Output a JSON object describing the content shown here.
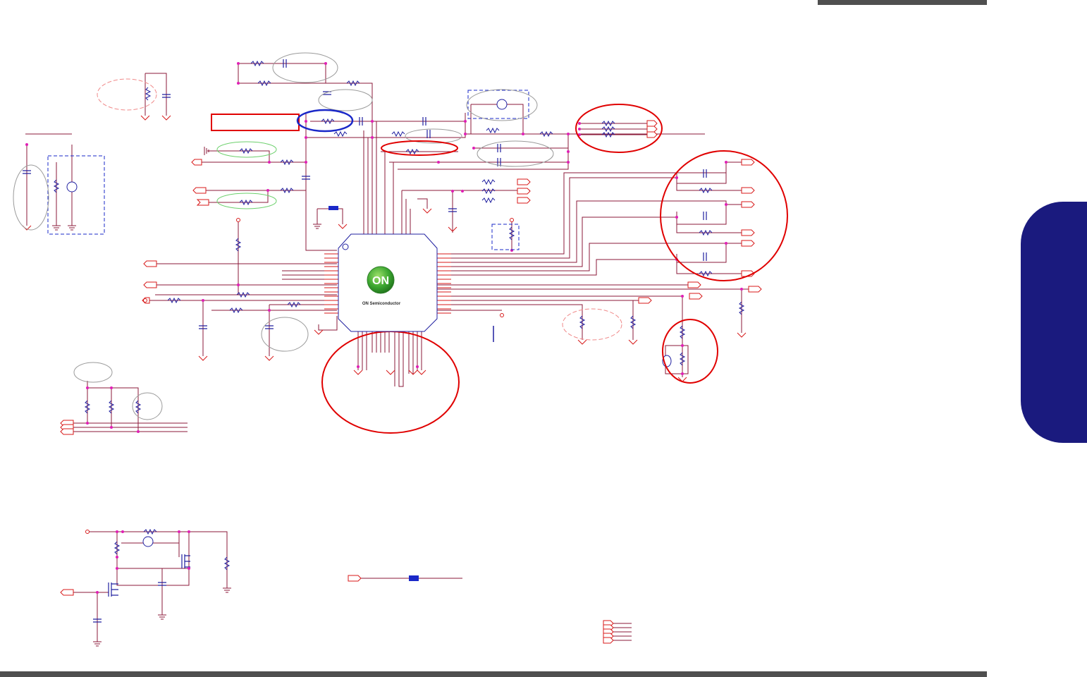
{
  "page": {
    "header_bar_color": "#4f4f4f",
    "footer_bar_color": "#4f4f4f",
    "side_tab_color": "#1a1a7e"
  },
  "schematic": {
    "wire_color": "#8b1a3a",
    "pin_color": "#e01fb5",
    "component_color": "#2020a0",
    "red_marker_color": "#e00000",
    "blue_marker_color": "#1a28c8",
    "chip": {
      "logo_text": "ON",
      "brand_text": "ON Semiconductor"
    }
  }
}
